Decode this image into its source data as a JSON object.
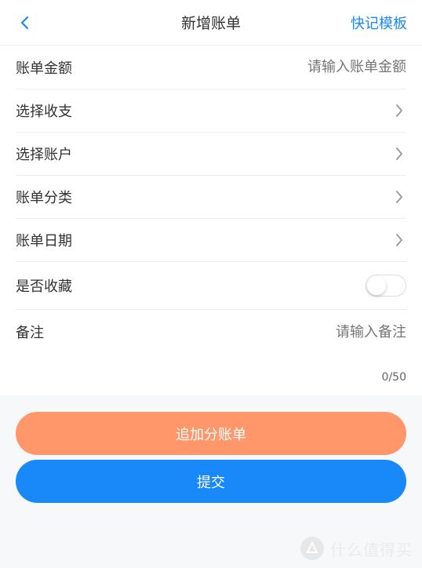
{
  "colors": {
    "accent": "#1989fa",
    "secondary_button": "#ff976a",
    "text": "#323233",
    "placeholder": "#c8c9cc"
  },
  "navbar": {
    "back_icon": "chevron-left-icon",
    "title": "新增账单",
    "right_action": "快记模板"
  },
  "form": {
    "amount": {
      "label": "账单金额",
      "placeholder": "请输入账单金额"
    },
    "income_expense": {
      "label": "选择收支",
      "icon": "chevron-right-icon"
    },
    "account": {
      "label": "选择账户",
      "icon": "chevron-right-icon"
    },
    "category": {
      "label": "账单分类",
      "icon": "chevron-right-icon"
    },
    "date": {
      "label": "账单日期",
      "icon": "chevron-right-icon"
    },
    "favorite": {
      "label": "是否收藏",
      "enabled": false
    },
    "remark": {
      "label": "备注",
      "placeholder": "请输入备注",
      "counter": "0/50"
    }
  },
  "buttons": {
    "split_bill": "追加分账单",
    "submit": "提交"
  },
  "watermark": {
    "text": "什么值得买"
  }
}
